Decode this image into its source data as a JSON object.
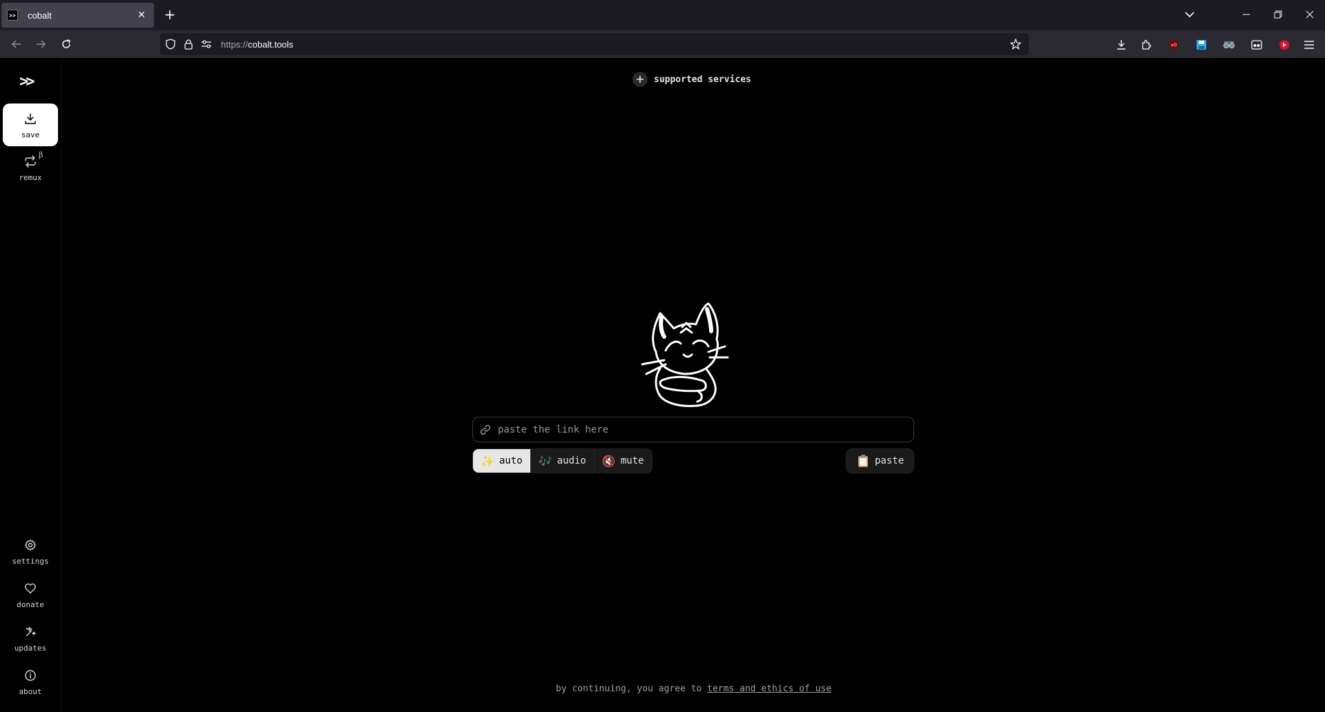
{
  "browser": {
    "tab_title": "cobalt",
    "tab_favicon": ">>",
    "url_protocol": "https://",
    "url_host": "cobalt.tools",
    "icons": [
      "close-icon",
      "plus-icon",
      "chevron-down-icon",
      "minimize-icon",
      "restore-icon",
      "back-icon",
      "forward-icon",
      "reload-icon",
      "shield-icon",
      "lock-icon",
      "permissions-icon",
      "star-icon",
      "download-icon",
      "extensions-icon",
      "ublock-icon",
      "floppy-icon",
      "glasses-icon",
      "reader-icon",
      "youtube-icon",
      "menu-icon"
    ]
  },
  "sidebar": {
    "logo": ">>",
    "items": [
      {
        "label": "save",
        "icon": "download-icon"
      },
      {
        "label": "remux",
        "icon": "remux-icon",
        "badge": "β"
      },
      {
        "label": "settings",
        "icon": "gear-icon"
      },
      {
        "label": "donate",
        "icon": "heart-icon"
      },
      {
        "label": "updates",
        "icon": "sparkle-icon"
      },
      {
        "label": "about",
        "icon": "info-icon"
      }
    ]
  },
  "main": {
    "services_label": "supported services",
    "input_placeholder": "paste the link here",
    "modes": [
      {
        "label": "auto",
        "emoji": "✨"
      },
      {
        "label": "audio",
        "emoji": "🎶"
      },
      {
        "label": "mute",
        "emoji": "🔇"
      }
    ],
    "paste_label": "paste",
    "footer_prefix": "by continuing, you agree to ",
    "footer_link": "terms and ethics of use"
  },
  "colors": {
    "background": "#000000",
    "tabbar": "#1c1b22",
    "navbar": "#2b2a33",
    "active_item": "#ffffff",
    "button_bg": "#1a1a1a"
  }
}
